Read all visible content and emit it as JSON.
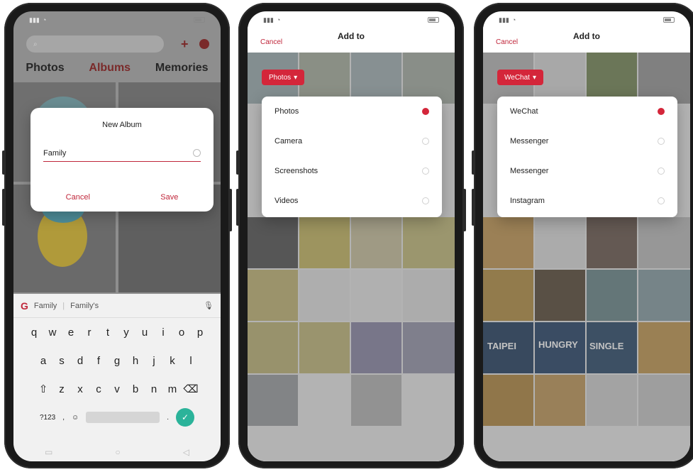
{
  "phone1": {
    "status": {
      "carrier": "",
      "right": ""
    },
    "search_placeholder": "",
    "tabs": [
      "Photos",
      "Albums",
      "Memories"
    ],
    "tiles": [
      {
        "caption": "",
        "sub": ""
      },
      {
        "caption": "",
        "sub": ""
      }
    ],
    "dialog": {
      "title": "New Album",
      "input_value": "Family",
      "cancel": "Cancel",
      "save": "Save"
    },
    "keyboard": {
      "suggestions": [
        "Family",
        "Family's"
      ],
      "row1": [
        "q",
        "w",
        "e",
        "r",
        "t",
        "y",
        "u",
        "i",
        "o",
        "p"
      ],
      "row2": [
        "a",
        "s",
        "d",
        "f",
        "g",
        "h",
        "j",
        "k",
        "l"
      ],
      "row3": [
        "z",
        "x",
        "c",
        "v",
        "b",
        "n",
        "m"
      ],
      "symbols_key": "?123",
      "comma": ","
    }
  },
  "phone2": {
    "header": {
      "cancel": "Cancel",
      "title": "Add to",
      "subtitle": "",
      "done": ""
    },
    "chip": "Photos",
    "options": [
      {
        "label": "Photos",
        "selected": true
      },
      {
        "label": "Camera",
        "selected": false
      },
      {
        "label": "Screenshots",
        "selected": false
      },
      {
        "label": "Videos",
        "selected": false
      }
    ]
  },
  "phone3": {
    "header": {
      "cancel": "Cancel",
      "title": "Add to",
      "subtitle": "",
      "done": ""
    },
    "chip": "WeChat",
    "options": [
      {
        "label": "WeChat",
        "selected": true
      },
      {
        "label": "Messenger",
        "selected": false
      },
      {
        "label": "Messenger",
        "selected": false
      },
      {
        "label": "Instagram",
        "selected": false
      }
    ],
    "signs": [
      "TAIPEI",
      "HUNGRY",
      "SINGLE"
    ]
  },
  "colors": {
    "accent": "#d4263a",
    "enter_key": "#2bb39a"
  }
}
